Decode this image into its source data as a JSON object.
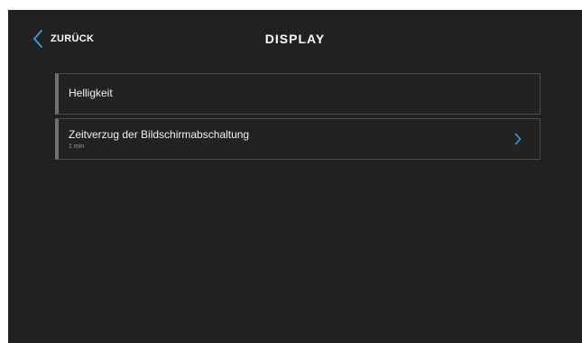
{
  "header": {
    "back_label": "ZURÜCK",
    "title": "DISPLAY"
  },
  "settings": {
    "items": [
      {
        "label": "Helligkeit",
        "has_chevron": false
      },
      {
        "label": "Zeitverzug der Bildschirmabschaltung",
        "value": "1 min",
        "has_chevron": true
      }
    ]
  },
  "icons": {
    "back": "chevron-left-icon",
    "item_arrow": "chevron-right-icon"
  },
  "colors": {
    "background": "#212121",
    "accent": "#2ea3f2",
    "text": "#ffffff",
    "subtext": "#9a9a9a",
    "item_border": "#4a4a4a",
    "item_marker": "#6f6f6f"
  }
}
